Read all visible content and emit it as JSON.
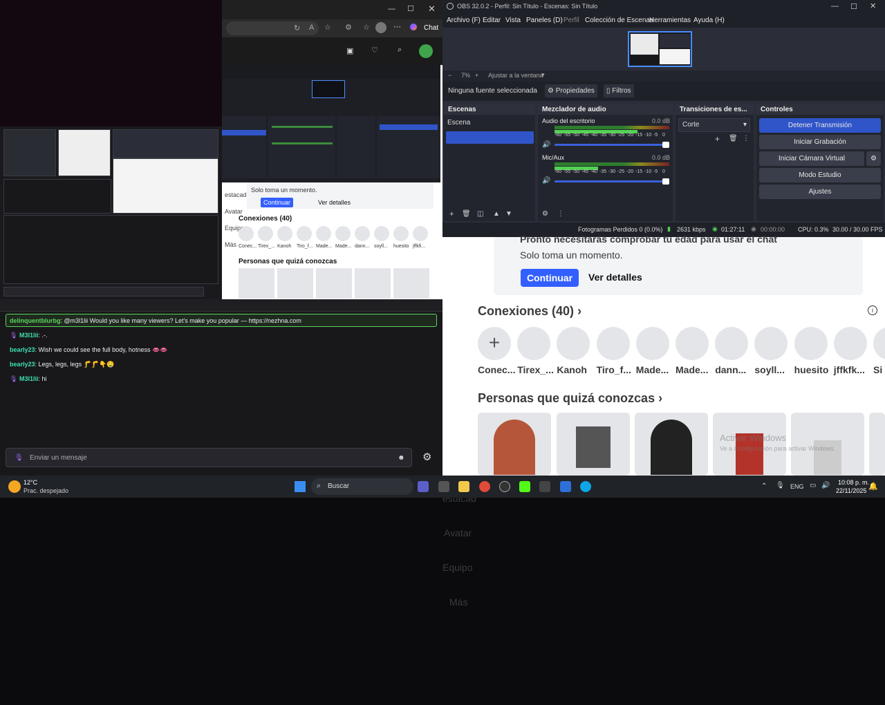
{
  "obs": {
    "title": "OBS 32.0.2 - Perfil: Sin Título - Escenas: Sin Título",
    "menu": [
      "Archivo (F)",
      "Editar",
      "Vista",
      "Paneles (D)",
      "Perfil",
      "Colección de Escenas",
      "Herramientas",
      "Ayuda (H)"
    ],
    "zoom": "7%",
    "fit_label": "Ajustar a la ventana",
    "no_source": "Ninguna fuente seleccionada",
    "properties": "Propiedades",
    "filters": "Filtros",
    "scenes_header": "Escenas",
    "scene_item": "Escena",
    "mixer_header": "Mezclador de audio",
    "desktop_audio": "Audio del escritorio",
    "desktop_db": "0.0 dB",
    "mic_audio": "Mic/Aux",
    "mic_db": "0.0 dB",
    "meter_ticks": [
      "-60",
      "-55",
      "-50",
      "-45",
      "-40",
      "-35",
      "-30",
      "-25",
      "-20",
      "-15",
      "-10",
      "-5",
      "0"
    ],
    "transitions_header": "Transiciones de es...",
    "transition_value": "Corte",
    "controls_header": "Controles",
    "btn_stop": "Detener Transmisión",
    "btn_record": "Iniciar Grabación",
    "btn_vcam": "Iniciar Cámara Virtual",
    "btn_studio": "Modo Estudio",
    "btn_settings": "Ajustes",
    "status_frames": "Fotogramas Perdidos 0 (0.0%)",
    "status_kbps": "2631 kbps",
    "status_time": "01:27:11",
    "status_rec": "00:00:00",
    "status_cpu": "CPU: 0.3%",
    "status_fps": "30.00 / 30.00 FPS",
    "desktop_level": 0.72,
    "mic_level": 0.38
  },
  "roblox": {
    "nav": [
      {
        "label": "estacad"
      },
      {
        "label": "Avatar"
      },
      {
        "label": "Equipo"
      },
      {
        "label": "Más"
      }
    ],
    "notice_title": "Pronto necesitarás comprobar tu edad para usar el chat",
    "notice_sub": "Solo toma un momento.",
    "continue_btn": "Continuar",
    "details_btn": "Ver detalles",
    "connections_title": "Conexiones (40)",
    "friends": [
      "Conec...",
      "Tirex_...",
      "Kanoh",
      "Tiro_f...",
      "Made...",
      "Made...",
      "dann...",
      "soyll...",
      "huesito",
      "jffkfk...",
      "Si"
    ],
    "people_title": "Personas que quizá conozcas",
    "watermark_1": "Activar Windows",
    "watermark_2": "Ve a Configuración para activar Windows."
  },
  "browser_small": {
    "connections_title": "Conexiones (40)",
    "friends": [
      "Conec...",
      "Tirex_...",
      "Kanoh",
      "Tiro_f...",
      "Made...",
      "Made...",
      "dann...",
      "soyll...",
      "huesito",
      "jffkfi..."
    ],
    "people_title": "Personas que quizá conozcas",
    "notice_sub": "Solo toma un momento.",
    "continue_btn": "Continuar",
    "details_btn": "Ver detalles",
    "nav": [
      "estacad",
      "Avatar",
      "Equipo",
      "Más"
    ],
    "copilot": "Chat"
  },
  "chat": {
    "messages": [
      {
        "user": "delinquentblurbg",
        "text": ": @m3l1lii Would you like many viewers? Let's make you popular — https://nezhna.com",
        "highlight": true
      },
      {
        "user": "M3l1lii",
        "text": ": .-.",
        "mod": true
      },
      {
        "user": "bearly23",
        "text": ": Wish we could see the full body, hotness 👄👄"
      },
      {
        "user": "bearly23",
        "text": ": Legs, legs, legs 🦵🦵👇🤤"
      },
      {
        "user": "M3l1lii",
        "text": ": hi",
        "mod": true
      }
    ],
    "input_placeholder": "Enviar un mensaje"
  },
  "taskbar": {
    "weather_temp": "12°C",
    "weather_desc": "Prac. despejado",
    "search": "Buscar",
    "lang": "ENG",
    "time": "10:08 p. m.",
    "date": "22/11/2025"
  },
  "colors": {
    "obs_accent": "#2f55c9",
    "roblox_blue": "#335fff",
    "chat_highlight": "#5bd45b"
  }
}
